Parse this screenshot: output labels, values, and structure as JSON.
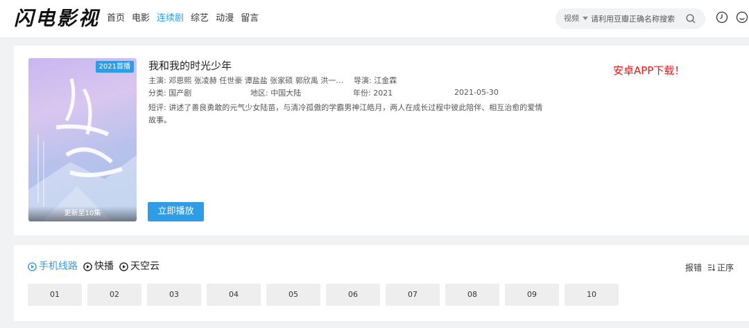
{
  "header": {
    "logo": "闪电影视",
    "nav": [
      "首页",
      "电影",
      "连续剧",
      "综艺",
      "动漫",
      "留言"
    ],
    "active_nav_index": 2,
    "search": {
      "type": "视频",
      "placeholder": "请利用豆瓣正确名称搜索"
    }
  },
  "detail": {
    "poster_badge": "2021首播",
    "poster_footer": "更新至10集",
    "title": "我和我的时光少年",
    "cast_label": "主演:",
    "cast": "邓恩熙 张凌赫 任世豪 谭盐盐 张家硕 郭欣禹 洪一…",
    "director_label": "导演:",
    "director": "江金霖",
    "category_label": "分类:",
    "category": "国产剧",
    "region_label": "地区:",
    "region": "中国大陆",
    "year_label": "年份:",
    "year": "2021",
    "date": "2021-05-30",
    "summary_label": "短评:",
    "summary_line1": "讲述了善良勇敢的元气少女陆苗，与清冷孤傲的学霸男神江皓月，两人在成长过程中彼此陪伴、相互治愈的爱情",
    "summary_line2": "故事。",
    "download": "安卓APP下载！",
    "play": "立即播放"
  },
  "episodes": {
    "sources": [
      "手机线路",
      "快播",
      "天空云"
    ],
    "active_source_index": 0,
    "report": "报错",
    "sort": "正序",
    "list": [
      "01",
      "02",
      "03",
      "04",
      "05",
      "06",
      "07",
      "08",
      "09",
      "10"
    ]
  },
  "colors": {
    "accent": "#2e9de6",
    "download": "#f01414",
    "background": "#f1f2f4"
  }
}
